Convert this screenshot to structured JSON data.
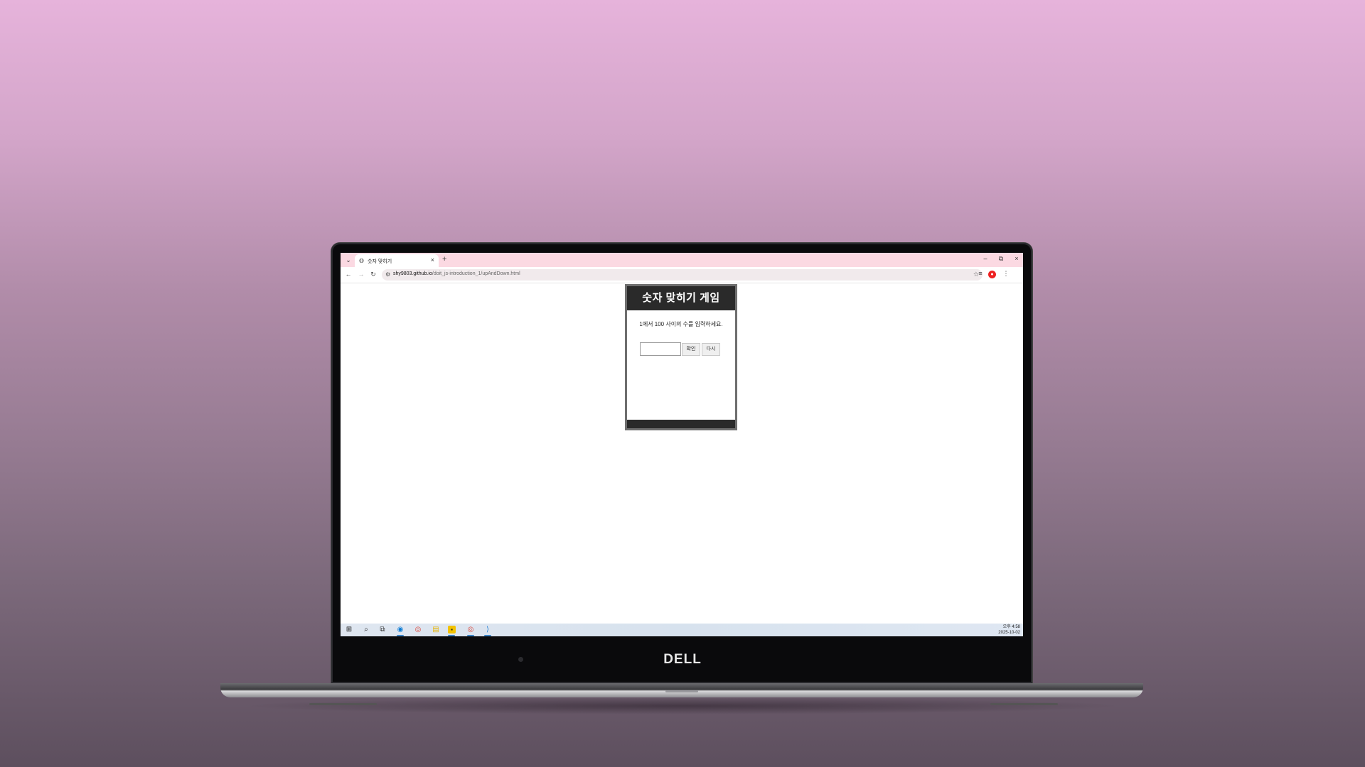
{
  "browser": {
    "tab_title": "숫자 맞히기",
    "new_tab": "+",
    "tab_dropdown": "⌄",
    "tab_close": "×",
    "window_controls": {
      "minimize": "–",
      "restore": "⧉",
      "close": "×"
    },
    "url_host": "shy9803.github.io",
    "url_path": "/doit_js-introduction_1/upAndDown.html"
  },
  "nav": {
    "back": "←",
    "forward": "→",
    "reload": "↻"
  },
  "game": {
    "title": "숫자 맞히기 게임",
    "message": "1에서 100 사이의 수를 입력하세요.",
    "input_value": "",
    "confirm_label": "확인",
    "retry_label": "다시"
  },
  "taskbar": {
    "time": "오후 4:58",
    "date": "2025-10-02",
    "icons": [
      "windows-start-icon",
      "search-icon",
      "task-view-icon",
      "edge-icon",
      "chrome-icon",
      "file-explorer-icon",
      "sticky-app-icon",
      "chrome-profile-icon",
      "vscode-icon"
    ]
  },
  "device": {
    "brand": "DELL"
  },
  "colors": {
    "tab_bar": "#fbd9e2",
    "game_header": "#2a2a2a",
    "taskbar": "#dfe6f0"
  }
}
